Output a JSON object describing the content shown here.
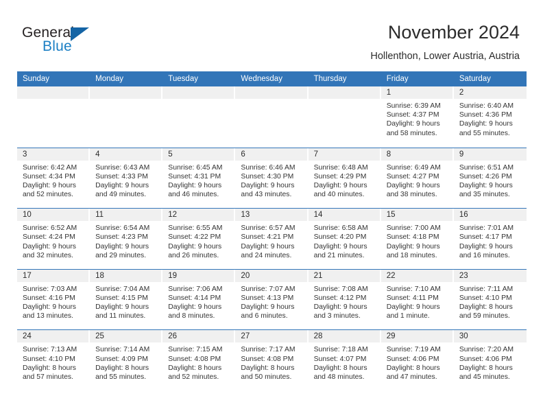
{
  "brand": {
    "word1": "General",
    "word2": "Blue",
    "logo_icon": "triangle-logo-icon",
    "colors": {
      "dark": "#231f20",
      "blue": "#1b7fc4",
      "triangle": "#1464a5"
    }
  },
  "header": {
    "title": "November 2024",
    "subtitle": "Hollenthon, Lower Austria, Austria"
  },
  "calendar": {
    "accent_color": "#3275b8",
    "daynum_band_color": "#f0f0f0",
    "weekday_headers": [
      "Sunday",
      "Monday",
      "Tuesday",
      "Wednesday",
      "Thursday",
      "Friday",
      "Saturday"
    ],
    "weeks": [
      [
        {
          "day": "",
          "lines": []
        },
        {
          "day": "",
          "lines": []
        },
        {
          "day": "",
          "lines": []
        },
        {
          "day": "",
          "lines": []
        },
        {
          "day": "",
          "lines": []
        },
        {
          "day": "1",
          "lines": [
            "Sunrise: 6:39 AM",
            "Sunset: 4:37 PM",
            "Daylight: 9 hours",
            "and 58 minutes."
          ]
        },
        {
          "day": "2",
          "lines": [
            "Sunrise: 6:40 AM",
            "Sunset: 4:36 PM",
            "Daylight: 9 hours",
            "and 55 minutes."
          ]
        }
      ],
      [
        {
          "day": "3",
          "lines": [
            "Sunrise: 6:42 AM",
            "Sunset: 4:34 PM",
            "Daylight: 9 hours",
            "and 52 minutes."
          ]
        },
        {
          "day": "4",
          "lines": [
            "Sunrise: 6:43 AM",
            "Sunset: 4:33 PM",
            "Daylight: 9 hours",
            "and 49 minutes."
          ]
        },
        {
          "day": "5",
          "lines": [
            "Sunrise: 6:45 AM",
            "Sunset: 4:31 PM",
            "Daylight: 9 hours",
            "and 46 minutes."
          ]
        },
        {
          "day": "6",
          "lines": [
            "Sunrise: 6:46 AM",
            "Sunset: 4:30 PM",
            "Daylight: 9 hours",
            "and 43 minutes."
          ]
        },
        {
          "day": "7",
          "lines": [
            "Sunrise: 6:48 AM",
            "Sunset: 4:29 PM",
            "Daylight: 9 hours",
            "and 40 minutes."
          ]
        },
        {
          "day": "8",
          "lines": [
            "Sunrise: 6:49 AM",
            "Sunset: 4:27 PM",
            "Daylight: 9 hours",
            "and 38 minutes."
          ]
        },
        {
          "day": "9",
          "lines": [
            "Sunrise: 6:51 AM",
            "Sunset: 4:26 PM",
            "Daylight: 9 hours",
            "and 35 minutes."
          ]
        }
      ],
      [
        {
          "day": "10",
          "lines": [
            "Sunrise: 6:52 AM",
            "Sunset: 4:24 PM",
            "Daylight: 9 hours",
            "and 32 minutes."
          ]
        },
        {
          "day": "11",
          "lines": [
            "Sunrise: 6:54 AM",
            "Sunset: 4:23 PM",
            "Daylight: 9 hours",
            "and 29 minutes."
          ]
        },
        {
          "day": "12",
          "lines": [
            "Sunrise: 6:55 AM",
            "Sunset: 4:22 PM",
            "Daylight: 9 hours",
            "and 26 minutes."
          ]
        },
        {
          "day": "13",
          "lines": [
            "Sunrise: 6:57 AM",
            "Sunset: 4:21 PM",
            "Daylight: 9 hours",
            "and 24 minutes."
          ]
        },
        {
          "day": "14",
          "lines": [
            "Sunrise: 6:58 AM",
            "Sunset: 4:20 PM",
            "Daylight: 9 hours",
            "and 21 minutes."
          ]
        },
        {
          "day": "15",
          "lines": [
            "Sunrise: 7:00 AM",
            "Sunset: 4:18 PM",
            "Daylight: 9 hours",
            "and 18 minutes."
          ]
        },
        {
          "day": "16",
          "lines": [
            "Sunrise: 7:01 AM",
            "Sunset: 4:17 PM",
            "Daylight: 9 hours",
            "and 16 minutes."
          ]
        }
      ],
      [
        {
          "day": "17",
          "lines": [
            "Sunrise: 7:03 AM",
            "Sunset: 4:16 PM",
            "Daylight: 9 hours",
            "and 13 minutes."
          ]
        },
        {
          "day": "18",
          "lines": [
            "Sunrise: 7:04 AM",
            "Sunset: 4:15 PM",
            "Daylight: 9 hours",
            "and 11 minutes."
          ]
        },
        {
          "day": "19",
          "lines": [
            "Sunrise: 7:06 AM",
            "Sunset: 4:14 PM",
            "Daylight: 9 hours",
            "and 8 minutes."
          ]
        },
        {
          "day": "20",
          "lines": [
            "Sunrise: 7:07 AM",
            "Sunset: 4:13 PM",
            "Daylight: 9 hours",
            "and 6 minutes."
          ]
        },
        {
          "day": "21",
          "lines": [
            "Sunrise: 7:08 AM",
            "Sunset: 4:12 PM",
            "Daylight: 9 hours",
            "and 3 minutes."
          ]
        },
        {
          "day": "22",
          "lines": [
            "Sunrise: 7:10 AM",
            "Sunset: 4:11 PM",
            "Daylight: 9 hours",
            "and 1 minute."
          ]
        },
        {
          "day": "23",
          "lines": [
            "Sunrise: 7:11 AM",
            "Sunset: 4:10 PM",
            "Daylight: 8 hours",
            "and 59 minutes."
          ]
        }
      ],
      [
        {
          "day": "24",
          "lines": [
            "Sunrise: 7:13 AM",
            "Sunset: 4:10 PM",
            "Daylight: 8 hours",
            "and 57 minutes."
          ]
        },
        {
          "day": "25",
          "lines": [
            "Sunrise: 7:14 AM",
            "Sunset: 4:09 PM",
            "Daylight: 8 hours",
            "and 55 minutes."
          ]
        },
        {
          "day": "26",
          "lines": [
            "Sunrise: 7:15 AM",
            "Sunset: 4:08 PM",
            "Daylight: 8 hours",
            "and 52 minutes."
          ]
        },
        {
          "day": "27",
          "lines": [
            "Sunrise: 7:17 AM",
            "Sunset: 4:08 PM",
            "Daylight: 8 hours",
            "and 50 minutes."
          ]
        },
        {
          "day": "28",
          "lines": [
            "Sunrise: 7:18 AM",
            "Sunset: 4:07 PM",
            "Daylight: 8 hours",
            "and 48 minutes."
          ]
        },
        {
          "day": "29",
          "lines": [
            "Sunrise: 7:19 AM",
            "Sunset: 4:06 PM",
            "Daylight: 8 hours",
            "and 47 minutes."
          ]
        },
        {
          "day": "30",
          "lines": [
            "Sunrise: 7:20 AM",
            "Sunset: 4:06 PM",
            "Daylight: 8 hours",
            "and 45 minutes."
          ]
        }
      ]
    ]
  }
}
